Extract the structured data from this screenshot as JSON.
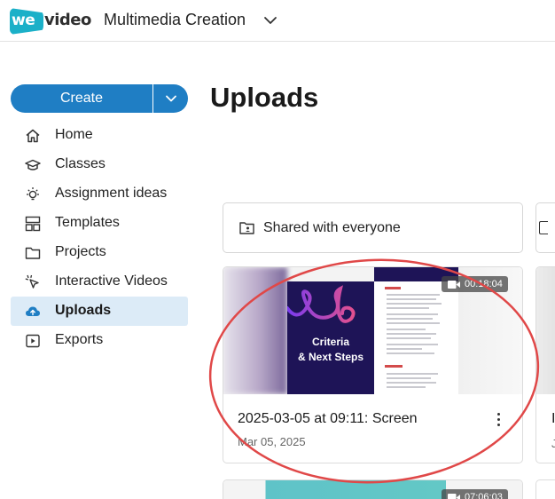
{
  "header": {
    "logo_mark": "we",
    "logo_word": "video",
    "workspace": "Multimedia Creation"
  },
  "create": {
    "label": "Create"
  },
  "sidebar": {
    "items": [
      {
        "label": "Home",
        "icon": "home-icon"
      },
      {
        "label": "Classes",
        "icon": "graduation-cap-icon"
      },
      {
        "label": "Assignment ideas",
        "icon": "lightbulb-icon"
      },
      {
        "label": "Templates",
        "icon": "templates-icon"
      },
      {
        "label": "Projects",
        "icon": "folder-icon"
      },
      {
        "label": "Interactive Videos",
        "icon": "cursor-click-icon"
      },
      {
        "label": "Uploads",
        "icon": "cloud-upload-icon",
        "active": true
      },
      {
        "label": "Exports",
        "icon": "play-box-icon"
      }
    ]
  },
  "main": {
    "title": "Uploads",
    "filter": {
      "label": "Shared with everyone",
      "icon": "shared-folder-icon"
    },
    "cards": [
      {
        "title": "2025-03-05 at 09:11: Screen",
        "date": "Mar 05, 2025",
        "duration": "00:18:04",
        "thumb_lines": [
          "Criteria",
          "& Next Steps"
        ]
      }
    ],
    "next_card": {
      "duration": "07:06:03"
    },
    "side_card": {
      "title_fragment": "I",
      "date_fragment": "J"
    }
  },
  "colors": {
    "accent": "#1f7ec4",
    "logo": "#1bb0c8",
    "active_nav": "#dcebf7",
    "annotation": "#e04848",
    "slide_dark": "#1e1457"
  }
}
